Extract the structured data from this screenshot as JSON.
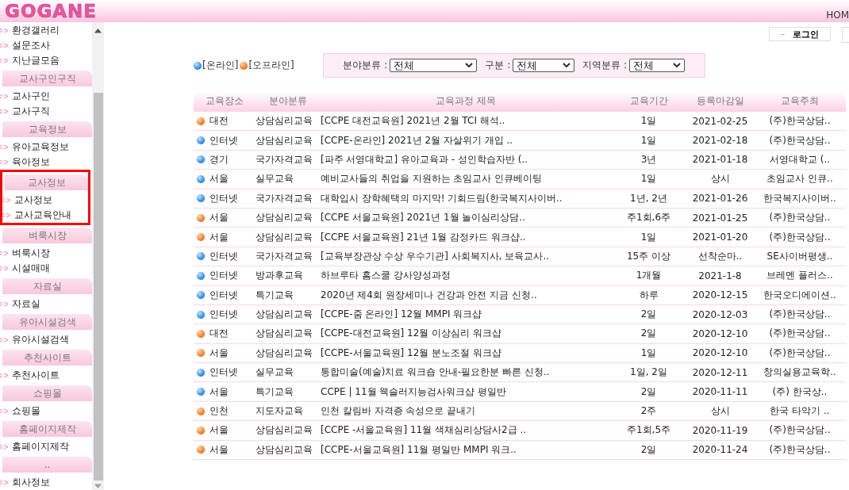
{
  "header": {
    "logo": "GOGANE",
    "nav_cut": "HOM"
  },
  "sidebar": {
    "sections": [
      {
        "highlighted": false,
        "items": [
          "환경갤러리",
          "설문조사",
          "지난글모음"
        ]
      },
      {
        "title": "교사구인구직",
        "highlighted": false,
        "items": [
          "교사구인",
          "교사구직"
        ]
      },
      {
        "title": "교육정보",
        "highlighted": false,
        "items": [
          "유아교육정보",
          "육아정보"
        ]
      },
      {
        "title": "교사정보",
        "highlighted": true,
        "items": [
          "교사정보",
          "교사교육안내"
        ]
      },
      {
        "title": "벼룩시장",
        "highlighted": false,
        "items": [
          "벼룩시장",
          "시설매매"
        ]
      },
      {
        "title": "자료실",
        "highlighted": false,
        "items": [
          "자료실"
        ]
      },
      {
        "title": "유아시설검색",
        "highlighted": false,
        "items": [
          "유아시설검색"
        ]
      },
      {
        "title": "추천사이트",
        "highlighted": false,
        "items": [
          "추천사이트"
        ]
      },
      {
        "title": "쇼핑몰",
        "highlighted": false,
        "items": [
          "쇼핑몰"
        ]
      },
      {
        "title": "홈페이지제작",
        "highlighted": false,
        "items": [
          "홈페이지제작"
        ]
      },
      {
        "title": "..",
        "highlighted": false,
        "items": [
          "회사정보"
        ]
      }
    ]
  },
  "login_button": "로그인",
  "legend": [
    {
      "kind": "online",
      "label": "[온라인]"
    },
    {
      "kind": "offline",
      "label": "[오프라인]"
    }
  ],
  "filters": [
    {
      "label": "분야분류 :",
      "value": "전체"
    },
    {
      "label": "구분 :",
      "value": "전체"
    },
    {
      "label": "지역분류 :",
      "value": "전체"
    }
  ],
  "table": {
    "columns": [
      "교육장소",
      "분야분류",
      "교육과정 제목",
      "교육기간",
      "등록마감일",
      "교육주최"
    ],
    "rows": [
      {
        "kind": "offline",
        "cells": [
          "대전",
          "상담심리교육",
          "[CCPE 대전교육원] 2021년 2월 TCI 해석..",
          "1일",
          "2021-02-25",
          "(주)한국상담.."
        ]
      },
      {
        "kind": "online",
        "cells": [
          "인터넷",
          "상담심리교육",
          "[CCPE-온라인] 2021년 2월 자살위기 개입 ..",
          "1일",
          "2021-02-18",
          "(주)한국상담.."
        ]
      },
      {
        "kind": "online",
        "cells": [
          "경기",
          "국가자격교육",
          "[파주 서영대학교] 유아교육과 - 성인학습자반 (..",
          "3년",
          "2021-01-18",
          "서영대학교 (.."
        ]
      },
      {
        "kind": "online",
        "cells": [
          "서울",
          "실무교육",
          "예비교사들의 취업을 지원하는 초임교사 인큐베이팅",
          "1일",
          "상시",
          "초임교사 인큐.."
        ]
      },
      {
        "kind": "online",
        "cells": [
          "인터넷",
          "국가자격교육",
          "대학입시 장학혜택의 마지막! 기회드림(한국복지사이버..",
          "1년, 2년",
          "2021-01-26",
          "한국복지사이버.."
        ]
      },
      {
        "kind": "offline",
        "cells": [
          "서울",
          "상담심리교육",
          "[CCPE 서울교육원] 2021년 1월 놀이심리상담..",
          "주1회,6주",
          "2021-01-25",
          "(주)한국상담.."
        ]
      },
      {
        "kind": "offline",
        "cells": [
          "서울",
          "상담심리교육",
          "[CCPE 서울교육원] 21년 1월 감정카드 워크샵..",
          "1일",
          "2021-01-20",
          "(주)한국상담.."
        ]
      },
      {
        "kind": "online",
        "cells": [
          "인터넷",
          "국가자격교육",
          "[교육부장관상 수상 우수기관] 사회복지사, 보육교사..",
          "15주 이상",
          "선착순마..",
          "SE사이버평생.."
        ]
      },
      {
        "kind": "online",
        "cells": [
          "인터넷",
          "방과후교육",
          "하브루타 홈스쿨 강사양성과정",
          "1개월",
          "2021-1-8",
          "브레멘 플러스.."
        ]
      },
      {
        "kind": "online",
        "cells": [
          "인터넷",
          "특기교육",
          "2020년 제4회 원장세미나 건강과 안전 지금 신청..",
          "하루",
          "2020-12-15",
          "한국오디에이션.."
        ]
      },
      {
        "kind": "online",
        "cells": [
          "인터넷",
          "상담심리교육",
          "[CCPE-줌 온라인] 12월 MMPI 워크샵",
          "2일",
          "2020-12-03",
          "(주)한국상담.."
        ]
      },
      {
        "kind": "offline",
        "cells": [
          "대전",
          "상담심리교육",
          "[CCPE-대전교육원] 12월 이상심리 워크샵",
          "2일",
          "2020-12-10",
          "(주)한국상담.."
        ]
      },
      {
        "kind": "offline",
        "cells": [
          "서울",
          "상담심리교육",
          "[CCPE-서울교육원] 12월 분노조절 워크샵",
          "1일",
          "2020-12-10",
          "(주)한국상담.."
        ]
      },
      {
        "kind": "online",
        "cells": [
          "인터넷",
          "실무교육",
          "통합미술(예술)치료 워크숍 안내-필요한분 빠른 신청..",
          "1일, 2일",
          "2020-12-11",
          "창의실용교육학.."
        ]
      },
      {
        "kind": "online",
        "cells": [
          "서울",
          "특기교육",
          "CCPE |  11월 웩슬러지능검사워크샵 평일반",
          "2일",
          "2020-11-11",
          "(주) 한국상.."
        ]
      },
      {
        "kind": "offline",
        "cells": [
          "인천",
          "지도자교육",
          "인천 칼림바 자격증 속성으로 끝내기",
          "2주",
          "상시",
          "한국 타악기 .."
        ]
      },
      {
        "kind": "offline",
        "cells": [
          "서울",
          "상담심리교육",
          "[CCPE -서울교육원] 11월 색채심리상담사2급 ..",
          "주1회,5주",
          "2020-11-19",
          "(주)한국상담.."
        ]
      },
      {
        "kind": "offline",
        "cells": [
          "서울",
          "상담심리교육",
          "[CCPE-서울교육원] 11월 평일반 MMPI 워크..",
          "2일",
          "2020-11-24",
          "(주)한국상담.."
        ]
      }
    ]
  }
}
